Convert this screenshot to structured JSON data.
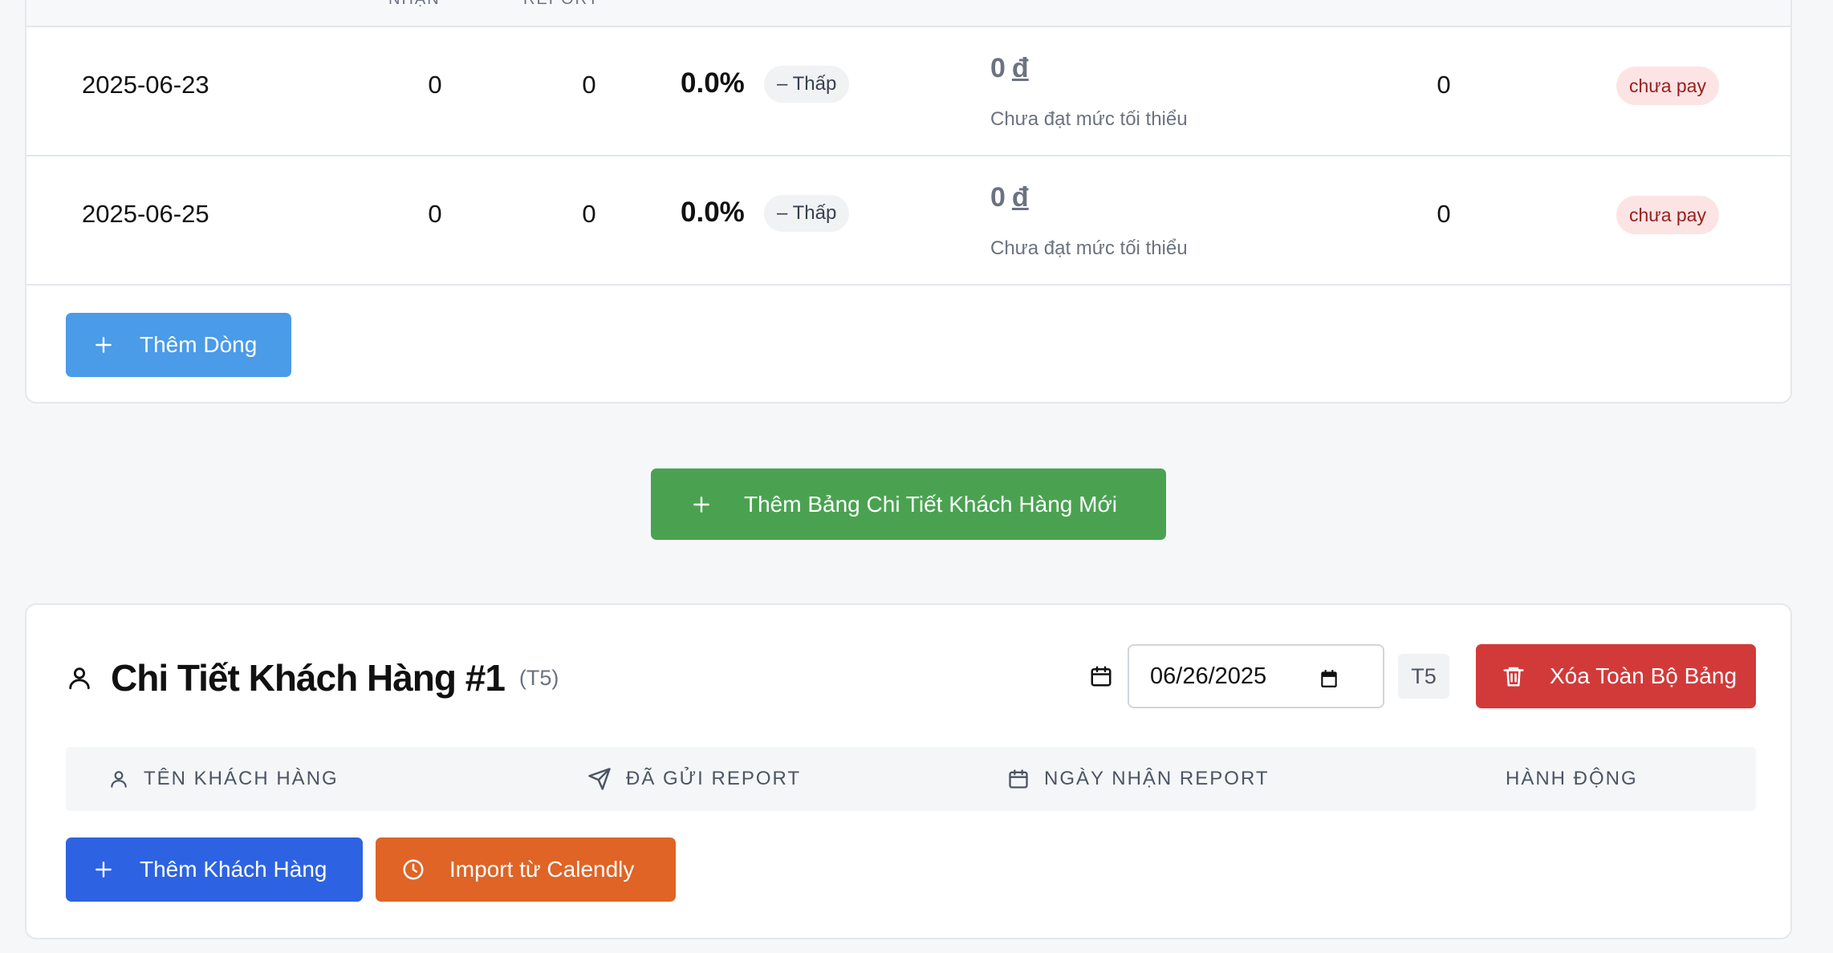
{
  "top_table": {
    "partial_headers": [
      "NHẬN",
      "REPORT"
    ],
    "rows": [
      {
        "date": "2025-06-23",
        "val1": "0",
        "val2": "0",
        "rate": "0.0%",
        "level": "Thấp",
        "amount": "0",
        "currency": "đ",
        "note": "Chưa đạt mức tối thiểu",
        "count": "0",
        "status": "chưa pay"
      },
      {
        "date": "2025-06-25",
        "val1": "0",
        "val2": "0",
        "rate": "0.0%",
        "level": "Thấp",
        "amount": "0",
        "currency": "đ",
        "note": "Chưa đạt mức tối thiểu",
        "count": "0",
        "status": "chưa pay"
      }
    ],
    "add_row_label": "Thêm Dòng"
  },
  "add_table_label": "Thêm Bảng Chi Tiết Khách Hàng Mới",
  "customer_table": {
    "title": "Chi Tiết Khách Hàng #1",
    "tag": "(T5)",
    "date_value": "06/26/2025",
    "month_chip": "T5",
    "delete_label": "Xóa Toàn Bộ Bảng",
    "headers": {
      "name": "TÊN KHÁCH HÀNG",
      "sent": "ĐÃ GỬI REPORT",
      "received": "NGÀY NHẬN REPORT",
      "action": "HÀNH ĐỘNG"
    },
    "add_customer_label": "Thêm Khách Hàng",
    "import_label": "Import từ Calendly"
  },
  "colors": {
    "add_row": "#4a9be8",
    "add_table": "#4aa251",
    "delete": "#d23a3a",
    "add_customer": "#2d63e2",
    "import": "#df6426",
    "status_bg": "#fde4e4",
    "status_text": "#9b1c1c"
  },
  "icons": [
    "plus-icon",
    "user-icon",
    "calendar-icon",
    "trash-icon",
    "send-icon",
    "clock-icon",
    "calendar-picker-icon"
  ]
}
